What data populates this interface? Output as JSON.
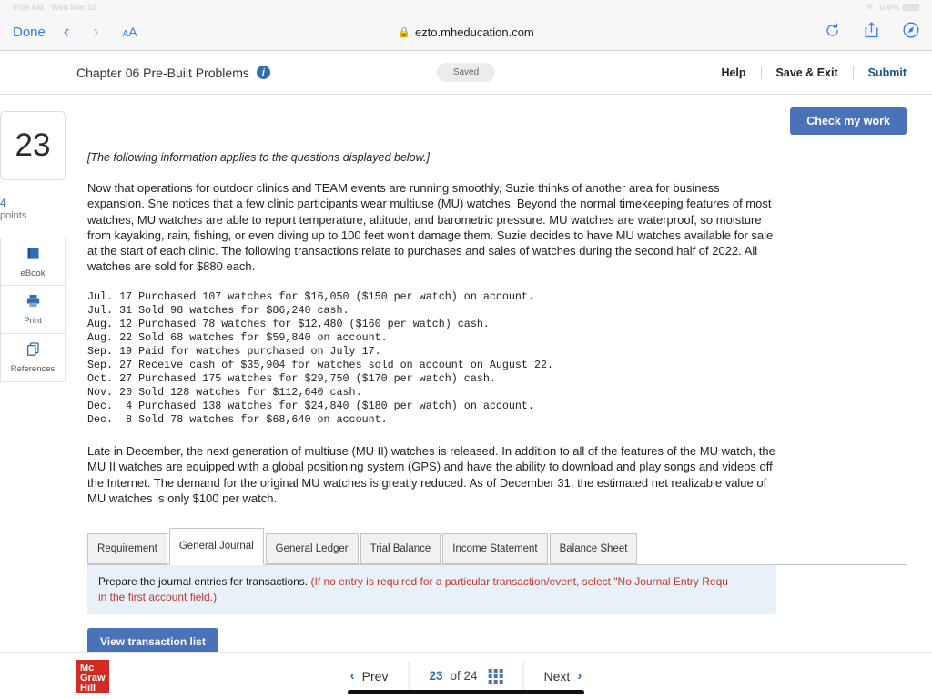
{
  "status_bar": {
    "time": "9:09 AM",
    "date": "Wed Mar 15",
    "wifi_icon": "wifi-icon",
    "battery_text": "100%"
  },
  "browser": {
    "done_label": "Done",
    "back_icon": "chevron-left-icon",
    "forward_icon": "chevron-right-icon",
    "text_size_small": "A",
    "text_size_large": "A",
    "lock_icon": "lock-icon",
    "url": "ezto.mheducation.com",
    "reload_icon": "reload-icon",
    "share_icon": "share-icon",
    "compass_icon": "compass-icon"
  },
  "header": {
    "title": "Chapter 06 Pre-Built Problems",
    "info_icon": "info-icon",
    "saved_badge": "Saved",
    "help_label": "Help",
    "save_exit_label": "Save & Exit",
    "submit_label": "Submit"
  },
  "sidebar": {
    "question_number": "23",
    "points_value": "4",
    "points_label": "points",
    "tools": [
      {
        "label": "eBook",
        "icon": "book-icon"
      },
      {
        "label": "Print",
        "icon": "printer-icon"
      },
      {
        "label": "References",
        "icon": "copy-pages-icon"
      }
    ]
  },
  "main": {
    "check_work_label": "Check my work",
    "intro_note": "[The following information applies to the questions displayed below.]",
    "paragraph_1": "Now that operations for outdoor clinics and TEAM events are running smoothly, Suzie thinks of another area for business expansion. She notices that a few clinic participants wear multiuse (MU) watches. Beyond the normal timekeeping features of most watches, MU watches are able to report temperature, altitude, and barometric pressure. MU watches are waterproof, so moisture from kayaking, rain, fishing, or even diving up to 100 feet won't damage them. Suzie decides to have MU watches available for sale at the start of each clinic. The following transactions relate to purchases and sales of watches during the second half of 2022. All watches are sold for $880 each.",
    "transactions": "Jul. 17 Purchased 107 watches for $16,050 ($150 per watch) on account.\nJul. 31 Sold 98 watches for $86,240 cash.\nAug. 12 Purchased 78 watches for $12,480 ($160 per watch) cash.\nAug. 22 Sold 68 watches for $59,840 on account.\nSep. 19 Paid for watches purchased on July 17.\nSep. 27 Receive cash of $35,904 for watches sold on account on August 22.\nOct. 27 Purchased 175 watches for $29,750 ($170 per watch) cash.\nNov. 20 Sold 128 watches for $112,640 cash.\nDec.  4 Purchased 138 watches for $24,840 ($180 per watch) on account.\nDec.  8 Sold 78 watches for $68,640 on account.",
    "paragraph_2": "Late in December, the next generation of multiuse (MU II) watches is released. In addition to all of the features of the MU watch, the MU II watches are equipped with a global positioning system (GPS) and have the ability to download and play songs and videos off the Internet. The demand for the original MU watches is greatly reduced. As of December 31, the estimated net realizable value of MU watches is only $100 per watch.",
    "tabs": [
      {
        "label": "Requirement",
        "active": false
      },
      {
        "label": "General Journal",
        "active": true
      },
      {
        "label": "General Ledger",
        "active": false
      },
      {
        "label": "Trial Balance",
        "active": false
      },
      {
        "label": "Income Statement",
        "active": false
      },
      {
        "label": "Balance Sheet",
        "active": false
      }
    ],
    "instruction_black": "Prepare the journal entries for transactions.",
    "instruction_red_line1": "(If no entry is required for a particular transaction/event, select \"No Journal Entry Requ",
    "instruction_red_line2": "in the first account field.)",
    "view_transaction_label": "View transaction list"
  },
  "footer": {
    "logo_line1": "Mc",
    "logo_line2": "Graw",
    "logo_line3": "Hill",
    "prev_label": "Prev",
    "prev_icon": "chevron-left-icon",
    "current_page": "23",
    "page_of": "of 24",
    "grid_icon": "grid-icon",
    "next_label": "Next",
    "next_icon": "chevron-right-icon"
  },
  "colors": {
    "accent_blue": "#4a72b8",
    "link_blue": "#2f6db5",
    "brand_red": "#d32b24",
    "banner_blue": "#e8f0f9",
    "warning_red": "#c0392b"
  }
}
